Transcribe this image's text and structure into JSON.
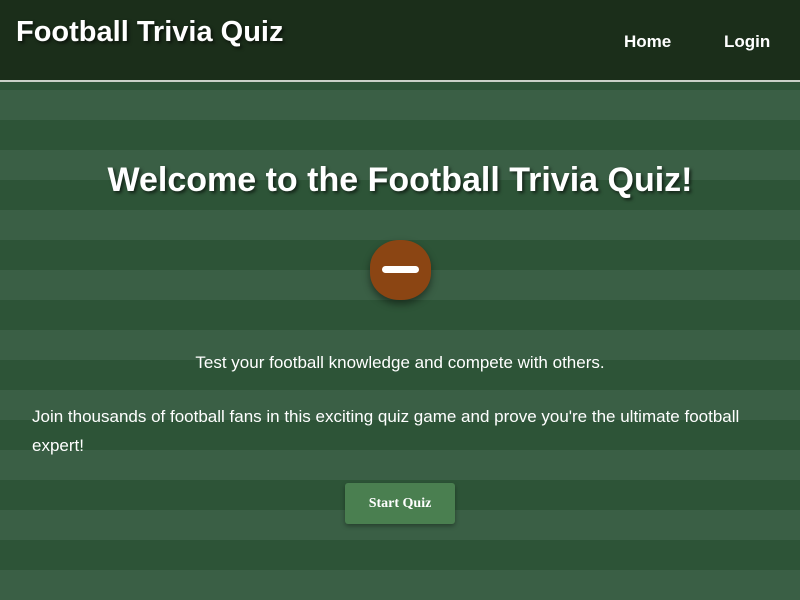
{
  "header": {
    "title": "Football Trivia Quiz",
    "nav": {
      "home_label": "Home",
      "login_label": "Login"
    }
  },
  "main": {
    "title": "Welcome to the Football Trivia Quiz!",
    "icon": "football-icon",
    "tagline": "Test your football knowledge and compete with others.",
    "description": "Join thousands of football fans in this exciting quiz game and prove you're the ultimate football expert!",
    "start_button_label": "Start Quiz"
  },
  "colors": {
    "header_bg": "#1b2e1a",
    "stripe_dark": "#2d5437",
    "stripe_light": "#3a5f45",
    "ball": "#8b4513",
    "button": "#4a7f50",
    "text": "#ffffff"
  }
}
